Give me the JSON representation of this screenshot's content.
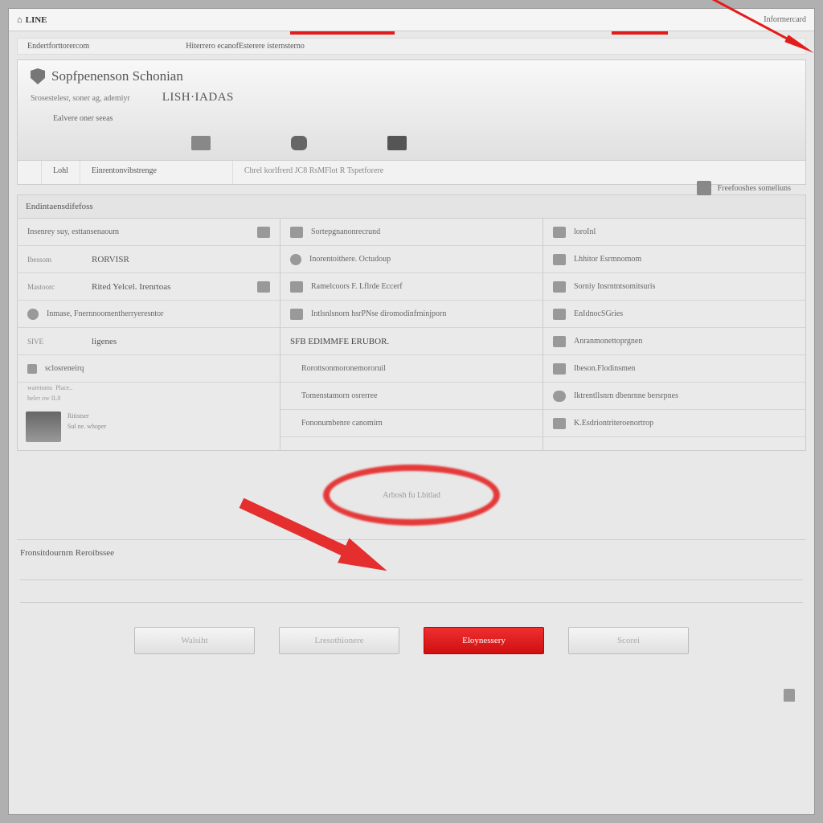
{
  "titlebar": {
    "brand": "LINE",
    "right": "Informercard"
  },
  "breadcrumb": {
    "a": "Endertforttorercom",
    "b": "Hiterrero ecanofEsterere isternsterno"
  },
  "header": {
    "title": "Sopfpenenson Schonian",
    "sub_label": "Srosestelesr, soner ag, ademiyr",
    "sub_value": "LISH·IADAS",
    "note": "Ealvere oner seeas",
    "right_badge": "Freefooshes someliuns"
  },
  "tabs": {
    "a": "Lohl",
    "b": "Einrentonvibstrenge",
    "note": "Chrel korlfrerd JC8 RsMFlot R Tspetforere"
  },
  "section": "Endintaensdifefoss",
  "col1": {
    "r1": "Insenrey suy, esttansenaoum",
    "r2_lbl": "Ibessom",
    "r2_val": "RORVISR",
    "r3_lbl": "Mastoorc",
    "r3_val": "Rited Yelcel. Irenrtoas",
    "r4": "Inmase, Fnernnoomentherryeresntor",
    "r5_lbl": "SIVE",
    "r5_val": "ligenes",
    "r6": "sclosreneirq",
    "r7_lbl": "waretoms",
    "r7_val": "Place..",
    "r8": "heler ow IL8",
    "thumb_a": "Ritistser",
    "thumb_b": "Sul ne. whoper"
  },
  "col2": {
    "r1": "Sortepgnanonrecrund",
    "r2": "Inorentoithere. Octudoup",
    "r3": "Ramelcoors F. Lflrde Eccerf",
    "r4": "Intlsnlsnorn hsrPNse diromodinfrninjporn",
    "heading": "SFB EDIMMFE ERUBOR.",
    "r5": "Rorottsonmoronemororuil",
    "r6": "Tomenstamorn osrerree",
    "r7": "Fononumbenre canomirn"
  },
  "col3": {
    "r1": "loroInl",
    "r2": "Lhhitor Esrmnomom",
    "r3": "Sorniy Insrntntsomitsuris",
    "r4": "EnIdnocSGries",
    "r5": "Anranmonettoprgnen",
    "r6": "Ibeson.Flodinsmen",
    "r7": "Iktrentllsnrn dbenrnne bersrpnes",
    "r8": "K.Esdriontriteroenortrop"
  },
  "highlight": "Arbosh fu Lbitlad",
  "footer": {
    "title": "Fronsitdournrn Reroibssee"
  },
  "buttons": {
    "a": "Walsiht",
    "b": "Lresothionere",
    "c": "Eloynessery",
    "d": "Scorei"
  }
}
